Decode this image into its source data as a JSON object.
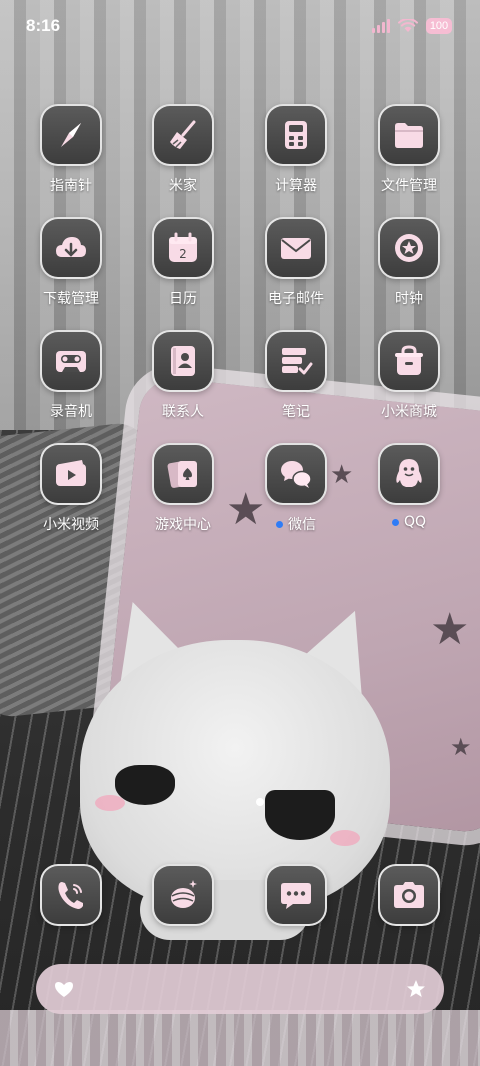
{
  "status_bar": {
    "time": "8:16",
    "battery": "100",
    "accent_color": "#f6bdd3"
  },
  "apps": [
    {
      "label": "指南针",
      "icon": "compass-icon"
    },
    {
      "label": "米家",
      "icon": "broom-icon"
    },
    {
      "label": "计算器",
      "icon": "calculator-icon"
    },
    {
      "label": "文件管理",
      "icon": "folder-icon"
    },
    {
      "label": "下载管理",
      "icon": "cloud-download-icon"
    },
    {
      "label": "日历",
      "icon": "calendar-icon",
      "date": "2"
    },
    {
      "label": "电子邮件",
      "icon": "mail-icon"
    },
    {
      "label": "时钟",
      "icon": "clock-icon"
    },
    {
      "label": "录音机",
      "icon": "cassette-icon"
    },
    {
      "label": "联系人",
      "icon": "contacts-icon"
    },
    {
      "label": "笔记",
      "icon": "notes-icon"
    },
    {
      "label": "小米商城",
      "icon": "store-icon"
    },
    {
      "label": "小米视频",
      "icon": "video-icon"
    },
    {
      "label": "游戏中心",
      "icon": "cards-icon"
    },
    {
      "label": "微信",
      "icon": "chat-bubbles-icon",
      "new_install_dot": true
    },
    {
      "label": "QQ",
      "icon": "penguin-icon",
      "new_install_dot": true
    }
  ],
  "dock": [
    {
      "icon": "phone-icon"
    },
    {
      "icon": "ball-icon"
    },
    {
      "icon": "message-icon"
    },
    {
      "icon": "camera-icon"
    }
  ],
  "search_bar": {
    "left_icon": "heart-icon",
    "right_icon": "star-icon"
  },
  "colors": {
    "icon_glyph": "#f8dbe6",
    "tile_top": "#5b5b5b",
    "tile_bottom": "#3d3d3d",
    "dot": "#2f7cf6",
    "search_bg": "#e2ccd6"
  }
}
